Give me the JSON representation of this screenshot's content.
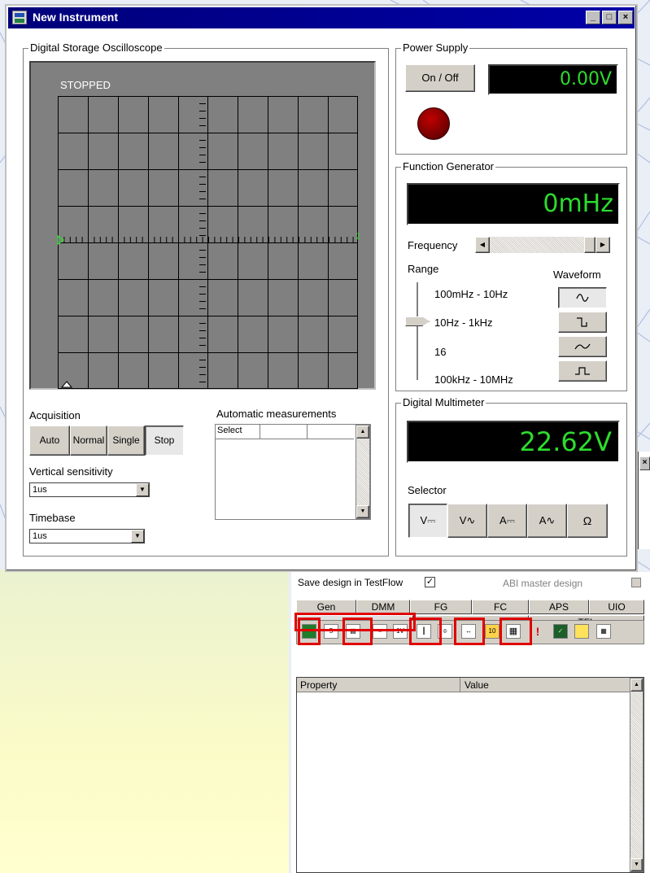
{
  "window": {
    "title": "New Instrument",
    "controls": [
      "_",
      "□",
      "×"
    ]
  },
  "oscilloscope": {
    "group_label": "Digital Storage Oscilloscope",
    "status": "STOPPED",
    "channel_marker": "2",
    "acquisition_label": "Acquisition",
    "acquisition_buttons": [
      "Auto",
      "Normal",
      "Single",
      "Stop"
    ],
    "acquisition_selected": "Stop",
    "auto_measurements_label": "Automatic measurements",
    "measurements_header": "Select",
    "vertical_label": "Vertical sensitivity",
    "vertical_value": "1us",
    "timebase_label": "Timebase",
    "timebase_value": "1us"
  },
  "power_supply": {
    "group_label": "Power Supply",
    "button": "On / Off",
    "display": "0.00V",
    "led_color": "#7a0000"
  },
  "function_generator": {
    "group_label": "Function Generator",
    "display": "0mHz",
    "frequency_label": "Frequency",
    "range_label": "Range",
    "waveform_label": "Waveform",
    "ranges": [
      "100mHz - 10Hz",
      "10Hz - 1kHz",
      "16",
      "100kHz - 10MHz"
    ],
    "waveform_icons": [
      "sine-wave-icon",
      "square-wave-icon",
      "triangle-wave-icon",
      "pulse-wave-icon"
    ]
  },
  "multimeter": {
    "group_label": "Digital Multimeter",
    "display": "22.62V",
    "selector_label": "Selector",
    "selector_buttons": [
      "V⎓",
      "V∿",
      "A⎓",
      "A∿",
      "Ω"
    ]
  },
  "design_panel": {
    "save_label": "Save design in TestFlow",
    "save_checked": "✓",
    "abi_label": "ABI master design",
    "tabs_row1": [
      "Gen",
      "DMM",
      "FG",
      "FC",
      "APS",
      "UIO"
    ],
    "tabs_row2": [
      "DSO",
      "VPS",
      "TFL"
    ],
    "active_tab": "DSO",
    "toolbar_icons": [
      "waveform-icon",
      "scale-icon",
      "auto-stop-icon",
      "measure-icon",
      "volt-icon",
      "cursor-icon",
      "trigger-icon",
      "probe-icon",
      "data-icon",
      "table-icon",
      "alert-icon",
      "display-icon",
      "note-icon",
      "export-icon"
    ],
    "grid_headers": [
      "Property",
      "Value"
    ]
  },
  "colors": {
    "lcd_text": "#2ddc2d",
    "title_bar": "#0000a8",
    "highlight": "#e00000"
  }
}
